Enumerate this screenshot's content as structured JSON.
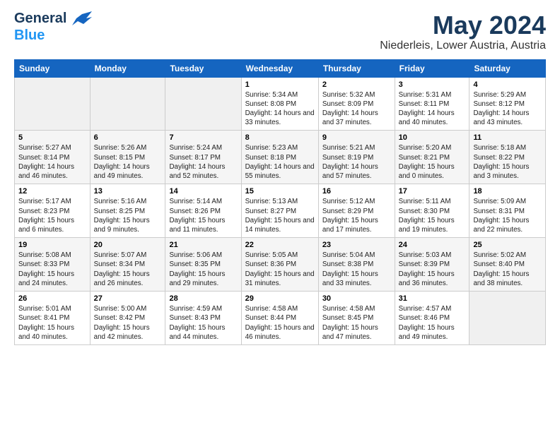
{
  "logo": {
    "general": "General",
    "blue": "Blue"
  },
  "title": "May 2024",
  "subtitle": "Niederleis, Lower Austria, Austria",
  "weekdays": [
    "Sunday",
    "Monday",
    "Tuesday",
    "Wednesday",
    "Thursday",
    "Friday",
    "Saturday"
  ],
  "weeks": [
    [
      {
        "day": "",
        "sunrise": "",
        "sunset": "",
        "daylight": ""
      },
      {
        "day": "",
        "sunrise": "",
        "sunset": "",
        "daylight": ""
      },
      {
        "day": "",
        "sunrise": "",
        "sunset": "",
        "daylight": ""
      },
      {
        "day": "1",
        "sunrise": "Sunrise: 5:34 AM",
        "sunset": "Sunset: 8:08 PM",
        "daylight": "Daylight: 14 hours and 33 minutes."
      },
      {
        "day": "2",
        "sunrise": "Sunrise: 5:32 AM",
        "sunset": "Sunset: 8:09 PM",
        "daylight": "Daylight: 14 hours and 37 minutes."
      },
      {
        "day": "3",
        "sunrise": "Sunrise: 5:31 AM",
        "sunset": "Sunset: 8:11 PM",
        "daylight": "Daylight: 14 hours and 40 minutes."
      },
      {
        "day": "4",
        "sunrise": "Sunrise: 5:29 AM",
        "sunset": "Sunset: 8:12 PM",
        "daylight": "Daylight: 14 hours and 43 minutes."
      }
    ],
    [
      {
        "day": "5",
        "sunrise": "Sunrise: 5:27 AM",
        "sunset": "Sunset: 8:14 PM",
        "daylight": "Daylight: 14 hours and 46 minutes."
      },
      {
        "day": "6",
        "sunrise": "Sunrise: 5:26 AM",
        "sunset": "Sunset: 8:15 PM",
        "daylight": "Daylight: 14 hours and 49 minutes."
      },
      {
        "day": "7",
        "sunrise": "Sunrise: 5:24 AM",
        "sunset": "Sunset: 8:17 PM",
        "daylight": "Daylight: 14 hours and 52 minutes."
      },
      {
        "day": "8",
        "sunrise": "Sunrise: 5:23 AM",
        "sunset": "Sunset: 8:18 PM",
        "daylight": "Daylight: 14 hours and 55 minutes."
      },
      {
        "day": "9",
        "sunrise": "Sunrise: 5:21 AM",
        "sunset": "Sunset: 8:19 PM",
        "daylight": "Daylight: 14 hours and 57 minutes."
      },
      {
        "day": "10",
        "sunrise": "Sunrise: 5:20 AM",
        "sunset": "Sunset: 8:21 PM",
        "daylight": "Daylight: 15 hours and 0 minutes."
      },
      {
        "day": "11",
        "sunrise": "Sunrise: 5:18 AM",
        "sunset": "Sunset: 8:22 PM",
        "daylight": "Daylight: 15 hours and 3 minutes."
      }
    ],
    [
      {
        "day": "12",
        "sunrise": "Sunrise: 5:17 AM",
        "sunset": "Sunset: 8:23 PM",
        "daylight": "Daylight: 15 hours and 6 minutes."
      },
      {
        "day": "13",
        "sunrise": "Sunrise: 5:16 AM",
        "sunset": "Sunset: 8:25 PM",
        "daylight": "Daylight: 15 hours and 9 minutes."
      },
      {
        "day": "14",
        "sunrise": "Sunrise: 5:14 AM",
        "sunset": "Sunset: 8:26 PM",
        "daylight": "Daylight: 15 hours and 11 minutes."
      },
      {
        "day": "15",
        "sunrise": "Sunrise: 5:13 AM",
        "sunset": "Sunset: 8:27 PM",
        "daylight": "Daylight: 15 hours and 14 minutes."
      },
      {
        "day": "16",
        "sunrise": "Sunrise: 5:12 AM",
        "sunset": "Sunset: 8:29 PM",
        "daylight": "Daylight: 15 hours and 17 minutes."
      },
      {
        "day": "17",
        "sunrise": "Sunrise: 5:11 AM",
        "sunset": "Sunset: 8:30 PM",
        "daylight": "Daylight: 15 hours and 19 minutes."
      },
      {
        "day": "18",
        "sunrise": "Sunrise: 5:09 AM",
        "sunset": "Sunset: 8:31 PM",
        "daylight": "Daylight: 15 hours and 22 minutes."
      }
    ],
    [
      {
        "day": "19",
        "sunrise": "Sunrise: 5:08 AM",
        "sunset": "Sunset: 8:33 PM",
        "daylight": "Daylight: 15 hours and 24 minutes."
      },
      {
        "day": "20",
        "sunrise": "Sunrise: 5:07 AM",
        "sunset": "Sunset: 8:34 PM",
        "daylight": "Daylight: 15 hours and 26 minutes."
      },
      {
        "day": "21",
        "sunrise": "Sunrise: 5:06 AM",
        "sunset": "Sunset: 8:35 PM",
        "daylight": "Daylight: 15 hours and 29 minutes."
      },
      {
        "day": "22",
        "sunrise": "Sunrise: 5:05 AM",
        "sunset": "Sunset: 8:36 PM",
        "daylight": "Daylight: 15 hours and 31 minutes."
      },
      {
        "day": "23",
        "sunrise": "Sunrise: 5:04 AM",
        "sunset": "Sunset: 8:38 PM",
        "daylight": "Daylight: 15 hours and 33 minutes."
      },
      {
        "day": "24",
        "sunrise": "Sunrise: 5:03 AM",
        "sunset": "Sunset: 8:39 PM",
        "daylight": "Daylight: 15 hours and 36 minutes."
      },
      {
        "day": "25",
        "sunrise": "Sunrise: 5:02 AM",
        "sunset": "Sunset: 8:40 PM",
        "daylight": "Daylight: 15 hours and 38 minutes."
      }
    ],
    [
      {
        "day": "26",
        "sunrise": "Sunrise: 5:01 AM",
        "sunset": "Sunset: 8:41 PM",
        "daylight": "Daylight: 15 hours and 40 minutes."
      },
      {
        "day": "27",
        "sunrise": "Sunrise: 5:00 AM",
        "sunset": "Sunset: 8:42 PM",
        "daylight": "Daylight: 15 hours and 42 minutes."
      },
      {
        "day": "28",
        "sunrise": "Sunrise: 4:59 AM",
        "sunset": "Sunset: 8:43 PM",
        "daylight": "Daylight: 15 hours and 44 minutes."
      },
      {
        "day": "29",
        "sunrise": "Sunrise: 4:58 AM",
        "sunset": "Sunset: 8:44 PM",
        "daylight": "Daylight: 15 hours and 46 minutes."
      },
      {
        "day": "30",
        "sunrise": "Sunrise: 4:58 AM",
        "sunset": "Sunset: 8:45 PM",
        "daylight": "Daylight: 15 hours and 47 minutes."
      },
      {
        "day": "31",
        "sunrise": "Sunrise: 4:57 AM",
        "sunset": "Sunset: 8:46 PM",
        "daylight": "Daylight: 15 hours and 49 minutes."
      },
      {
        "day": "",
        "sunrise": "",
        "sunset": "",
        "daylight": ""
      }
    ]
  ]
}
